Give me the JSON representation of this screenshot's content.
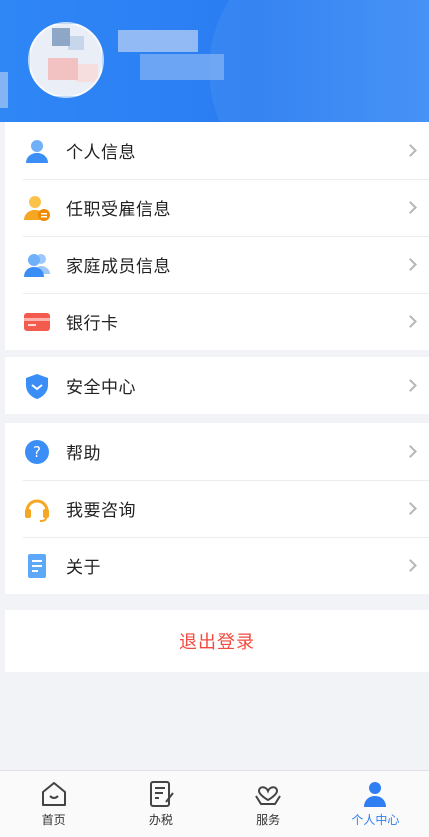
{
  "header": {
    "avatar_icon": "avatar",
    "background": "#2f86f5"
  },
  "groups": [
    {
      "items": [
        {
          "label": "个人信息",
          "icon": "person-icon",
          "color": "#3a8ef5"
        },
        {
          "label": "任职受雇信息",
          "icon": "employment-icon",
          "color": "#f5a623"
        },
        {
          "label": "家庭成员信息",
          "icon": "family-icon",
          "color": "#3a8ef5"
        },
        {
          "label": "银行卡",
          "icon": "bank-card-icon",
          "color": "#f35b4f"
        }
      ]
    },
    {
      "items": [
        {
          "label": "安全中心",
          "icon": "shield-icon",
          "color": "#3a8ef5"
        }
      ]
    },
    {
      "items": [
        {
          "label": "帮助",
          "icon": "help-icon",
          "color": "#3a8ef5"
        },
        {
          "label": "我要咨询",
          "icon": "headset-icon",
          "color": "#f5a623"
        },
        {
          "label": "关于",
          "icon": "document-icon",
          "color": "#3a8ef5"
        }
      ]
    }
  ],
  "logout": {
    "label": "退出登录",
    "color": "#f24a3e"
  },
  "tabbar": {
    "tabs": [
      {
        "label": "首页",
        "icon": "home-icon"
      },
      {
        "label": "办税",
        "icon": "tax-form-icon"
      },
      {
        "label": "服务",
        "icon": "service-heart-icon"
      },
      {
        "label": "个人中心",
        "icon": "profile-icon",
        "active": true
      }
    ],
    "active_color": "#2f7ff2"
  }
}
